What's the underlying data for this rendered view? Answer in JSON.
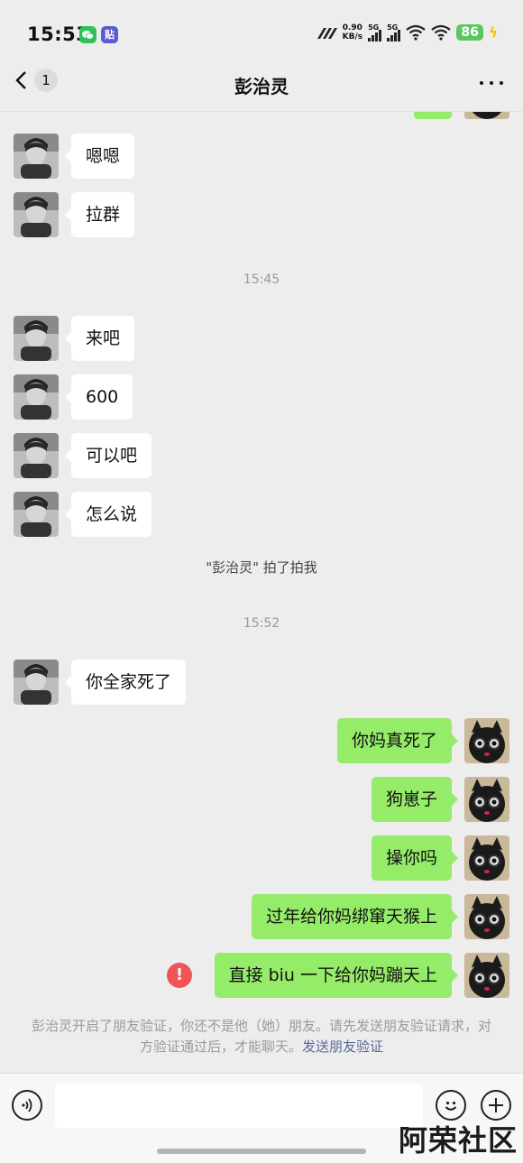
{
  "status_bar": {
    "time": "15:53",
    "app_icons": [
      "wechat-icon",
      "tieba-icon"
    ],
    "tieba_glyph": "贴",
    "net_speed_value": "0.90",
    "net_speed_unit": "KB/s",
    "sim1": "5G",
    "sim2": "5G",
    "battery": "86",
    "charging": "ϟ"
  },
  "header": {
    "title": "彭治灵",
    "unread_count": "1"
  },
  "messages": {
    "top_partial": "",
    "m1": "嗯嗯",
    "m2": "拉群",
    "time1": "15:45",
    "m3": "来吧",
    "m4": "600",
    "m5": "可以吧",
    "m6": "怎么说",
    "pat": "\"彭治灵\" 拍了拍我",
    "time2": "15:52",
    "m7": "你全家死了",
    "s1": "你妈真死了",
    "s2": "狗崽子",
    "s3": "操你吗",
    "s4": "过年给你妈绑窜天猴上",
    "s5": "直接 biu 一下给你妈蹦天上",
    "failed_mark": "!"
  },
  "notice": {
    "text": "彭治灵开启了朋友验证，你还不是他（她）朋友。请先发送朋友验证请求，对方验证通过后，才能聊天。",
    "link": "发送朋友验证"
  },
  "input_bar": {
    "placeholder": ""
  },
  "watermark": "阿荣社区",
  "colors": {
    "background": "#ededed",
    "incoming_bubble": "#ffffff",
    "outgoing_bubble": "#95ec69",
    "link": "#576b95",
    "error": "#f05454",
    "battery": "#5bc85e"
  }
}
